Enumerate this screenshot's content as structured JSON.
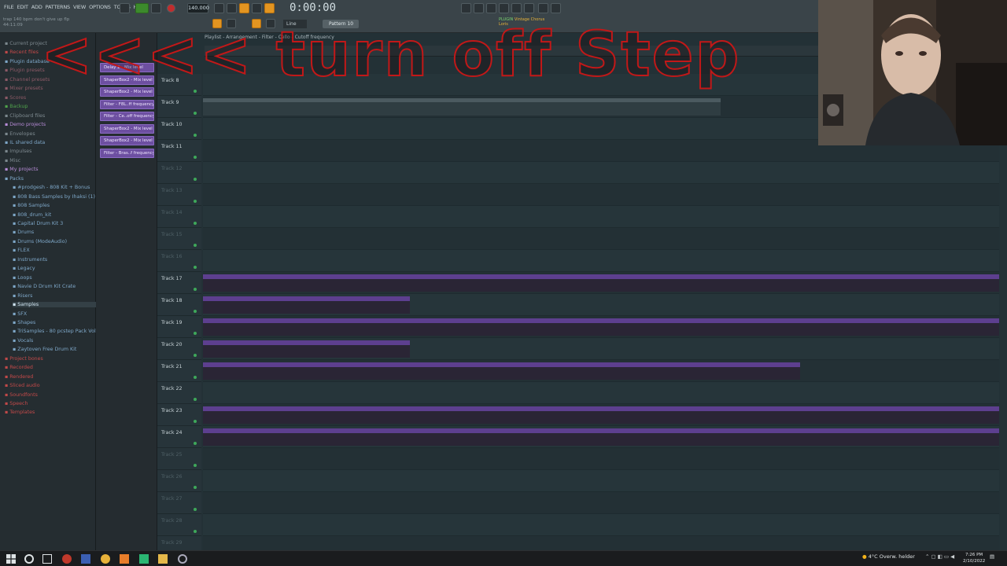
{
  "menubar": {
    "menu": [
      "FILE",
      "EDIT",
      "ADD",
      "PATTERNS",
      "VIEW",
      "OPTIONS",
      "TOOLS",
      "HELP"
    ],
    "song_info": [
      "trap 140 bpm don't give up flp",
      "44:11:09"
    ],
    "tempo": "140.000",
    "time": "0:00:00",
    "pattern": "Pattern 10",
    "snap": "Line",
    "hint_lines": [
      "Vintage Chorus",
      "Loris"
    ],
    "hint_label": "PLUGIN"
  },
  "overlay_text": "<<<< turn off Step",
  "browser": {
    "items": [
      {
        "label": "Current project",
        "color": "#7d898f"
      },
      {
        "label": "Recent files",
        "color": "#c24949"
      },
      {
        "label": "Plugin database",
        "color": "#7ea7c8"
      },
      {
        "label": "Plugin presets",
        "color": "#8d5a67"
      },
      {
        "label": "Channel presets",
        "color": "#8d5a67"
      },
      {
        "label": "Mixer presets",
        "color": "#8d5a67"
      },
      {
        "label": "Scores",
        "color": "#8d5a67"
      },
      {
        "label": "Backup",
        "color": "#4fa34b"
      },
      {
        "label": "Clipboard files",
        "color": "#7d898f"
      },
      {
        "label": "Demo projects",
        "color": "#b88cd8"
      },
      {
        "label": "Envelopes",
        "color": "#7d898f"
      },
      {
        "label": "IL shared data",
        "color": "#7ea7c8"
      },
      {
        "label": "Impulses",
        "color": "#7d898f"
      },
      {
        "label": "Misc",
        "color": "#7d898f"
      },
      {
        "label": "My projects",
        "color": "#b88cd8"
      },
      {
        "label": "Packs",
        "color": "#7ea7c8"
      },
      {
        "label": "#prodgesh - 808 Kit + Bonus",
        "color": "#7ea7c8"
      },
      {
        "label": "808 Bass Samples by Ihaksi (1)",
        "color": "#7ea7c8"
      },
      {
        "label": "808 Samples",
        "color": "#7ea7c8"
      },
      {
        "label": "808_drum_kit",
        "color": "#7ea7c8"
      },
      {
        "label": "Capital Drum Kit 3",
        "color": "#7ea7c8"
      },
      {
        "label": "Drums",
        "color": "#7ea7c8"
      },
      {
        "label": "Drums (ModeAudio)",
        "color": "#7ea7c8"
      },
      {
        "label": "FLEX",
        "color": "#7ea7c8"
      },
      {
        "label": "Instruments",
        "color": "#7ea7c8"
      },
      {
        "label": "Legacy",
        "color": "#7ea7c8"
      },
      {
        "label": "Loops",
        "color": "#7ea7c8"
      },
      {
        "label": "Navie D Drum Kit Crate",
        "color": "#7ea7c8"
      },
      {
        "label": "Risers",
        "color": "#7ea7c8"
      },
      {
        "label": "Samples",
        "color": "#cfe3ef"
      },
      {
        "label": "SFX",
        "color": "#7ea7c8"
      },
      {
        "label": "Shapes",
        "color": "#7ea7c8"
      },
      {
        "label": "TriSamples - 80 pcstep Pack Vol 1",
        "color": "#7ea7c8"
      },
      {
        "label": "Vocals",
        "color": "#7ea7c8"
      },
      {
        "label": "Zaytoven Free Drum Kit",
        "color": "#7ea7c8"
      },
      {
        "label": "Project bones",
        "color": "#c24949"
      },
      {
        "label": "Recorded",
        "color": "#c24949"
      },
      {
        "label": "Rendered",
        "color": "#c24949"
      },
      {
        "label": "Sliced audio",
        "color": "#c24949"
      },
      {
        "label": "Soundfonts",
        "color": "#c24949"
      },
      {
        "label": "Speech",
        "color": "#c24949"
      },
      {
        "label": "Templates",
        "color": "#c24949"
      }
    ]
  },
  "clip_sources": [
    "Delay 2 - Mix level",
    "ShaperBox2 - Mix level",
    "ShaperBox2 - Mix level #2",
    "Filter - F8L..ff frequency",
    "Filter - Ce..off frequency",
    "ShaperBox2 - Mix level #3",
    "ShaperBox2 - Mix level #4",
    "Filter - Bras..f frequency"
  ],
  "playlist": {
    "title": "Playlist - Arrangement - Filter - Cello - Cutoff frequency",
    "tracks": [
      {
        "name": "Track 8",
        "active": true,
        "clips": []
      },
      {
        "name": "Track 9",
        "active": true,
        "clips": [
          {
            "type": "pattern",
            "label": "Pattern 9",
            "start": 0,
            "end": 0.65
          }
        ]
      },
      {
        "name": "Track 10",
        "active": true,
        "clips": []
      },
      {
        "name": "Track 11",
        "active": true,
        "clips": []
      },
      {
        "name": "Track 12",
        "active": false,
        "clips": []
      },
      {
        "name": "Track 13",
        "active": false,
        "clips": []
      },
      {
        "name": "Track 14",
        "active": false,
        "clips": []
      },
      {
        "name": "Track 15",
        "active": false,
        "clips": []
      },
      {
        "name": "Track 16",
        "active": false,
        "clips": []
      },
      {
        "name": "Track 17",
        "active": true,
        "clips": [
          {
            "type": "auto",
            "label": "Filter - Cello - Cutoff frequency",
            "start": 0,
            "end": 1
          }
        ]
      },
      {
        "name": "Track 18",
        "active": true,
        "clips": [
          {
            "type": "auto",
            "label": "Filter - FBBeats 140 bpm Key A# - Cutoff frequency",
            "start": 0,
            "end": 0.26
          }
        ]
      },
      {
        "name": "Track 19",
        "active": true,
        "clips": [
          {
            "type": "auto",
            "label": "Delay 2 - Mix level",
            "start": 0,
            "end": 1
          }
        ]
      },
      {
        "name": "Track 20",
        "active": true,
        "clips": [
          {
            "type": "auto",
            "label": "ShaperBox2 - Mix level #2",
            "start": 0,
            "end": 0.26
          }
        ]
      },
      {
        "name": "Track 21",
        "active": true,
        "clips": [
          {
            "type": "auto",
            "label": "ShaperBox2 - Mix level",
            "start": 0,
            "end": 0.75
          }
        ]
      },
      {
        "name": "Track 22",
        "active": true,
        "clips": []
      },
      {
        "name": "Track 23",
        "active": true,
        "clips": [
          {
            "type": "auto",
            "label": "ShaperBox2 - Mix level #4",
            "start": 0,
            "end": 1
          }
        ]
      },
      {
        "name": "Track 24",
        "active": true,
        "clips": [
          {
            "type": "auto",
            "label": "Filter - Brass Section 2 - Cutoff frequency",
            "start": 0,
            "end": 1
          }
        ]
      },
      {
        "name": "Track 25",
        "active": false,
        "clips": []
      },
      {
        "name": "Track 26",
        "active": false,
        "clips": []
      },
      {
        "name": "Track 27",
        "active": false,
        "clips": []
      },
      {
        "name": "Track 28",
        "active": false,
        "clips": []
      },
      {
        "name": "Track 29",
        "active": false,
        "clips": []
      }
    ]
  },
  "taskbar": {
    "weather": "4°C Overw. helder",
    "time": "7:26 PM",
    "date": "2/10/2022"
  }
}
